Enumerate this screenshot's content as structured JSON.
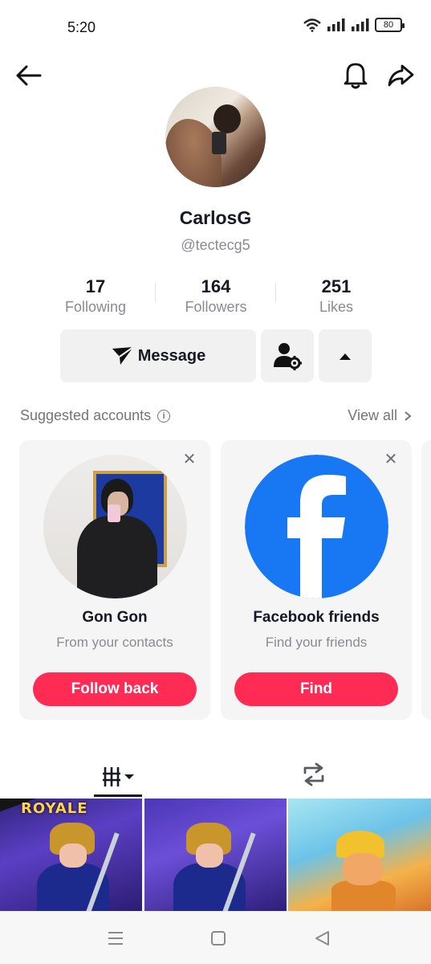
{
  "status_bar": {
    "time": "5:20",
    "battery": "80"
  },
  "profile": {
    "display_name": "CarlosG",
    "handle": "@tectecg5",
    "stats": [
      {
        "value": "17",
        "label": "Following"
      },
      {
        "value": "164",
        "label": "Followers"
      },
      {
        "value": "251",
        "label": "Likes"
      }
    ]
  },
  "actions": {
    "message_label": "Message"
  },
  "suggested": {
    "title": "Suggested accounts",
    "view_all": "View all",
    "cards": [
      {
        "name": "Gon Gon",
        "subtitle": "From your contacts",
        "button": "Follow back"
      },
      {
        "name": "Facebook friends",
        "subtitle": "Find your friends",
        "button": "Find"
      }
    ]
  },
  "thumbnails": {
    "first_title": "ROYALE"
  },
  "colors": {
    "accent": "#fe2c55",
    "text_primary": "#161823",
    "text_secondary": "#8a8b91",
    "button_grey": "#f1f1f2",
    "facebook_blue": "#1877f2"
  },
  "icons": {
    "nav": [
      "back-arrow-icon",
      "bell-icon",
      "share-icon"
    ],
    "actions": [
      "send-icon",
      "person-settings-icon",
      "caret-up-icon"
    ],
    "tabs": [
      "grid-sort-icon",
      "repost-icon"
    ],
    "system": [
      "menu-icon",
      "home-icon",
      "back-triangle-icon"
    ]
  }
}
